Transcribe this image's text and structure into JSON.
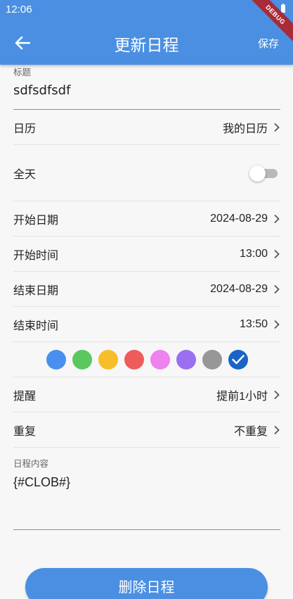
{
  "status_bar": {
    "time": "12:06",
    "debug_label": "DEBUG"
  },
  "app_bar": {
    "title": "更新日程",
    "save_label": "保存"
  },
  "title_field": {
    "label": "标题",
    "value": "sdfsdfsdf"
  },
  "rows": {
    "calendar": {
      "label": "日历",
      "value": "我的日历"
    },
    "all_day": {
      "label": "全天",
      "enabled": false
    },
    "start_date": {
      "label": "开始日期",
      "value": "2024-08-29"
    },
    "start_time": {
      "label": "开始时间",
      "value": "13:00"
    },
    "end_date": {
      "label": "结束日期",
      "value": "2024-08-29"
    },
    "end_time": {
      "label": "结束时间",
      "value": "13:50"
    },
    "reminder": {
      "label": "提醒",
      "value": "提前1小时"
    },
    "repeat": {
      "label": "重复",
      "value": "不重复"
    }
  },
  "colors": [
    {
      "hex": "#4a8ff0",
      "selected": false
    },
    {
      "hex": "#5ac85f",
      "selected": false
    },
    {
      "hex": "#f7be2a",
      "selected": false
    },
    {
      "hex": "#ed5c5a",
      "selected": false
    },
    {
      "hex": "#ee82ee",
      "selected": false
    },
    {
      "hex": "#9a6ff0",
      "selected": false
    },
    {
      "hex": "#979797",
      "selected": false
    },
    {
      "hex": "#1b63c7",
      "selected": true
    }
  ],
  "content_field": {
    "label": "日程内容",
    "value": "{#CLOB#}"
  },
  "delete_label": "删除日程",
  "theme": {
    "primary": "#4a8fe2",
    "background": "#f7f7f7"
  }
}
